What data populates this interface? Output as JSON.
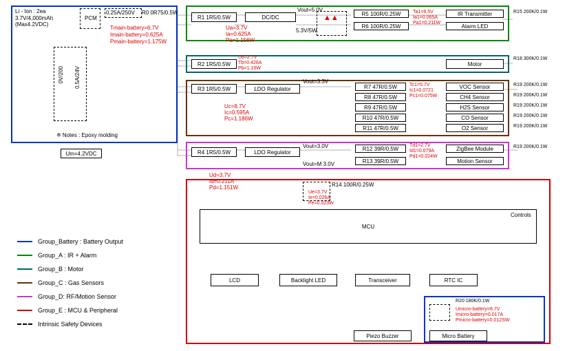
{
  "battery": {
    "title": "Li - Ion : 2ea\n3.7V/4,000mAh\n(Max4.2VDC)",
    "pcm": "PCM",
    "fuse": "0.25A/250V",
    "r0": "R0 0R75/0.5W",
    "meas1": "Tmain-battery=6.7V",
    "meas2": "Imain-battery=0.625A",
    "meas3": "Pmain-battery=1.175W",
    "vert_left": "0V/200",
    "vert_right": "0.5A/24V",
    "note": "※ Notes : Epoxy molding",
    "um": "Um=4.2VDC"
  },
  "group_a": {
    "r1": "R1 1R5/0.5W",
    "dcdc": "DC/DC",
    "vout": "Vout=5.0V",
    "params": [
      "Ua=3.7V",
      "Ia=0.625A",
      "Pa=1.156W"
    ],
    "zener": "5.3V/5W",
    "r5": "R5 100R/0.25W",
    "r6": "R6 100R/0.25W",
    "ir_params": [
      "Ta1=6.5V",
      "Ia1=0.065A",
      "Pa1=0.211W"
    ],
    "ir_tx": "IR Transmitter",
    "alarm": "Alarm LED",
    "r15": "R15 200K/0.1W"
  },
  "group_b": {
    "r2": "R2 1R5/0.5W",
    "params": [
      "Ub=2.7V",
      "Tb=0.426A",
      "Pb=1.15W"
    ],
    "motor": "Motor",
    "r18": "R18 300K/0.1W"
  },
  "group_c": {
    "r3": "R3 1R5/0.5W",
    "ldo": "LDO Regulator",
    "vout": "Vout=3.3V",
    "params": [
      "Uc=8.7V",
      "Ic=0.595A",
      "Pc=1.186W"
    ],
    "res": [
      "R7 47R/0.5W",
      "R8 47R/0.5W",
      "R9 47R/0.5W",
      "R10 47R/0.5W",
      "R11 47R/0.5W"
    ],
    "sens_params": [
      "Tc1=5.7V",
      "Ic1=0.0721",
      "Pc1=0.075W"
    ],
    "sensors": [
      "VOC Sensor",
      "CH4 Sensor",
      "H2S Sensor",
      "CO Sensor",
      "O2 Sensor"
    ],
    "r19": "R19 200K/0.1W"
  },
  "group_d": {
    "r4": "R4 1R5/0.5W",
    "ldo": "LDO Regulator",
    "vout": "Vout=3.0V",
    "vout_m": "Vout=M 3.0V",
    "params": [
      "Ud=3.7V",
      "Id=0.211A",
      "Pd=1.151W"
    ],
    "r12": "R12 39R/0.5W",
    "r13": "R13 39R/0.5W",
    "zb_params": [
      "Td1=2.7V",
      "Id1=0.079A",
      "Pd1=0.024W"
    ],
    "zigbee": "ZigBee Module",
    "motion": "Motion Sensor",
    "r19b": "R19 200K/0.1W"
  },
  "group_e": {
    "r14": "R14 100R/0.25W",
    "params": [
      "Ue=3.7V",
      "Ie=0.026A",
      "Pe=0.023W"
    ],
    "mcu": "MCU",
    "controls": "Controls",
    "blocks": [
      "LCD",
      "Backlight LED",
      "Transceiver",
      "RTC IC"
    ],
    "piezo": "Piezo Buzzer",
    "micro": "Micro Battery",
    "r20": "R20 180K/0.1W",
    "mb_params": [
      "Umicro-battery=6.7V",
      "Imicro-battery=0.017A",
      "Pmicro-battery=0.012SW"
    ]
  },
  "legend": {
    "battery": "Group_Battery : Battery Output",
    "a": "Group_A : IR + Alarm",
    "b": "Group_B : Motor",
    "c": "Group_C : Gas Sensors",
    "d": "Group_D: RF/Motion Sensor",
    "e": "Group_E : MCU & Peripheral",
    "intrinsic": "Intrinsic Safety Devices"
  },
  "colors": {
    "battery": "#0033cc",
    "a": "#008800",
    "b": "#006666",
    "c": "#663300",
    "d": "#cc33cc",
    "e": "#cc0000"
  }
}
